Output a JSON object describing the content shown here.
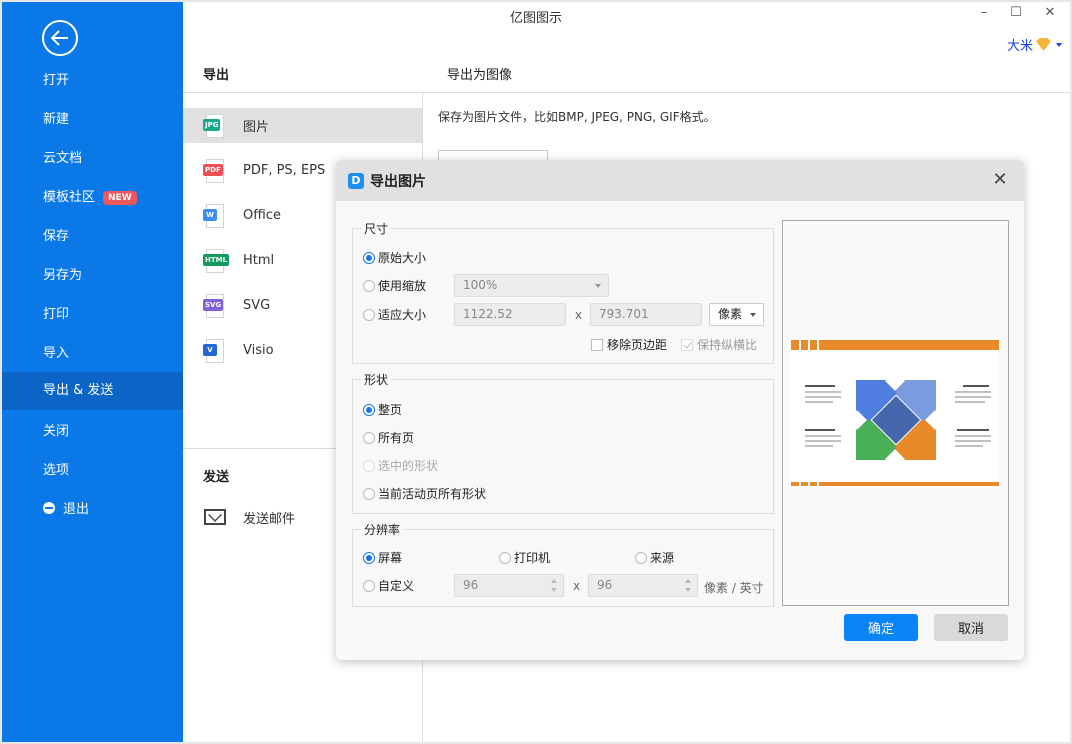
{
  "app": {
    "title": "亿图图示",
    "user_name": "大米"
  },
  "window_controls": {
    "minimize": "–",
    "maximize": "☐",
    "close": "✕"
  },
  "sidebar": {
    "back_icon": "arrow-left-circle-icon",
    "items": [
      {
        "label": "打开"
      },
      {
        "label": "新建"
      },
      {
        "label": "云文档"
      },
      {
        "label": "模板社区",
        "badge": "NEW"
      },
      {
        "label": "保存"
      },
      {
        "label": "另存为"
      },
      {
        "label": "打印"
      },
      {
        "label": "导入"
      },
      {
        "label": "导出 & 发送",
        "active": true
      },
      {
        "label": "关闭"
      },
      {
        "label": "选项"
      },
      {
        "label": "退出",
        "icon": "minus-circle-icon"
      }
    ]
  },
  "export": {
    "heading": "导出",
    "items": [
      {
        "label": "图片",
        "tag": "JPG",
        "color": "#1aa88c",
        "active": true
      },
      {
        "label": "PDF, PS, EPS",
        "tag": "PDF",
        "color": "#f04f54"
      },
      {
        "label": "Office",
        "tag": "W",
        "color": "#3d8ff5"
      },
      {
        "label": "Html",
        "tag": "HTML",
        "color": "#159a5e"
      },
      {
        "label": "SVG",
        "tag": "SVG",
        "color": "#8062d6"
      },
      {
        "label": "Visio",
        "tag": "V",
        "color": "#2266d8"
      }
    ],
    "send_heading": "发送",
    "send_items": [
      {
        "label": "发送邮件",
        "icon": "mail-send-icon"
      }
    ]
  },
  "right_panel": {
    "title": "导出为图像",
    "description": "保存为图片文件，比如BMP, JPEG, PNG, GIF格式。"
  },
  "dialog": {
    "title": "导出图片",
    "size_group": {
      "legend": "尺寸",
      "options": [
        {
          "label": "原始大小",
          "checked": true
        },
        {
          "label": "使用缩放",
          "checked": false
        },
        {
          "label": "适应大小",
          "checked": false
        }
      ],
      "zoom_value": "100%",
      "width_value": "1122.52",
      "height_value": "793.701",
      "times": "x",
      "unit": "像素",
      "remove_margin": {
        "label": "移除页边距",
        "checked": false
      },
      "keep_ratio": {
        "label": "保持纵横比",
        "checked": true,
        "disabled": true
      }
    },
    "shape_group": {
      "legend": "形状",
      "options": [
        {
          "label": "整页",
          "checked": true
        },
        {
          "label": "所有页",
          "checked": false
        },
        {
          "label": "选中的形状",
          "checked": false,
          "disabled": true
        },
        {
          "label": "当前活动页所有形状",
          "checked": false
        }
      ]
    },
    "resolution_group": {
      "legend": "分辨率",
      "options": [
        {
          "label": "屏幕",
          "checked": true
        },
        {
          "label": "打印机",
          "checked": false
        },
        {
          "label": "来源",
          "checked": false
        },
        {
          "label": "自定义",
          "checked": false
        }
      ],
      "dpi_x": "96",
      "dpi_y": "96",
      "times": "x",
      "unit": "像素 / 英寸"
    },
    "ok_label": "确定",
    "cancel_label": "取消",
    "preview_colors": {
      "blue": "#4f7de0",
      "lightblue": "#7b9be0",
      "green": "#49b058",
      "orange": "#e88a2a",
      "center": "#4466aa"
    }
  }
}
